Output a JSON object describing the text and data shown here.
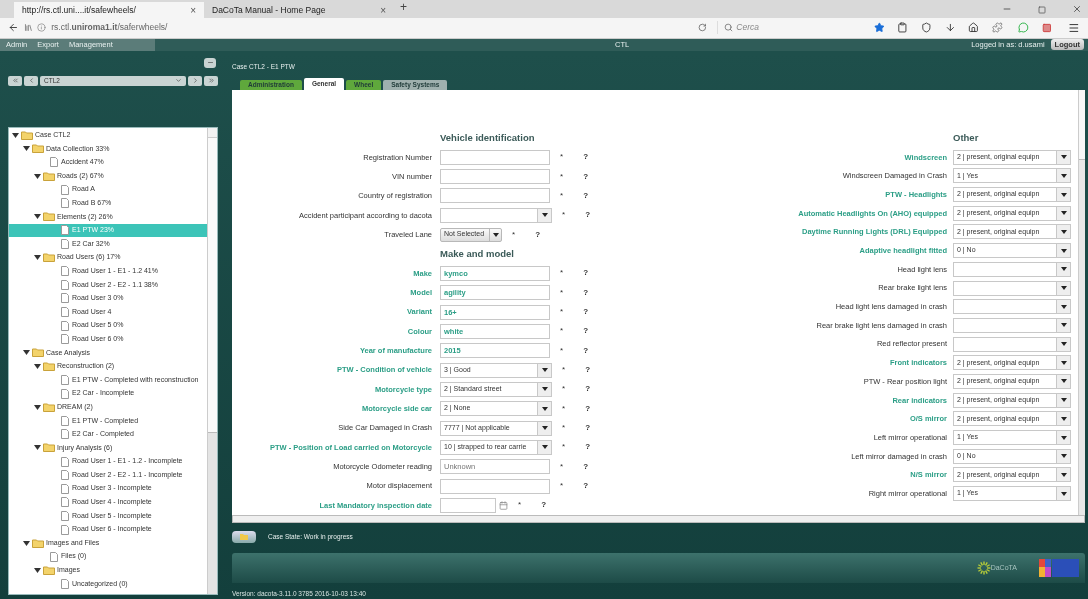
{
  "browser": {
    "tabs": [
      {
        "label": "http://rs.ctl.uni....it/safewheels/",
        "selected": true,
        "close": "×"
      },
      {
        "label": "DaCoTa Manual - Home Page",
        "selected": false,
        "close": "×"
      }
    ],
    "new_tab": "+",
    "url": "rs.ctl.**uniroma1.it**/saferwheels/",
    "search": {
      "placeholder": "Cerca"
    }
  },
  "app_bar": {
    "menu": [
      "Admin",
      "Export",
      "Management"
    ],
    "title": "CTL",
    "user": "Logged in as: d.usami",
    "logout": "Logout"
  },
  "navigator": {
    "case_select": "CTL2"
  },
  "tree": [
    {
      "label": "Case CTL2",
      "kind": "folder",
      "expanded": true,
      "selected": false,
      "children": [
        {
          "label": "Data Collection 33%",
          "kind": "folder",
          "expanded": true,
          "selected": false,
          "children": [
            {
              "label": "Accident 47%",
              "kind": "file",
              "selected": false
            },
            {
              "label": "Roads (2) 67%",
              "kind": "folder",
              "expanded": true,
              "selected": false,
              "children": [
                {
                  "label": "Road A",
                  "kind": "file",
                  "selected": false
                },
                {
                  "label": "Road B 67%",
                  "kind": "file",
                  "selected": false
                }
              ]
            },
            {
              "label": "Elements (2) 26%",
              "kind": "folder",
              "expanded": true,
              "selected": false,
              "children": [
                {
                  "label": "E1 PTW 23%",
                  "kind": "file",
                  "selected": true
                },
                {
                  "label": "E2 Car 32%",
                  "kind": "file",
                  "selected": false
                }
              ]
            },
            {
              "label": "Road Users (6) 17%",
              "kind": "folder",
              "expanded": true,
              "selected": false,
              "children": [
                {
                  "label": "Road User 1 - E1 - 1.2 41%",
                  "kind": "file",
                  "selected": false
                },
                {
                  "label": "Road User 2 - E2 - 1.1 38%",
                  "kind": "file",
                  "selected": false
                },
                {
                  "label": "Road User 3 0%",
                  "kind": "file",
                  "selected": false
                },
                {
                  "label": "Road User 4",
                  "kind": "file",
                  "selected": false
                },
                {
                  "label": "Road User 5 0%",
                  "kind": "file",
                  "selected": false
                },
                {
                  "label": "Road User 6 0%",
                  "kind": "file",
                  "selected": false
                }
              ]
            }
          ]
        },
        {
          "label": "Case Analysis",
          "kind": "folder",
          "expanded": true,
          "selected": false,
          "children": [
            {
              "label": "Reconstruction (2)",
              "kind": "folder",
              "expanded": true,
              "selected": false,
              "children": [
                {
                  "label": "E1 PTW - Completed with reconstruction",
                  "kind": "file",
                  "selected": false
                },
                {
                  "label": "E2 Car - Incomplete",
                  "kind": "file",
                  "selected": false
                }
              ]
            },
            {
              "label": "DREAM (2)",
              "kind": "folder",
              "expanded": true,
              "selected": false,
              "children": [
                {
                  "label": "E1 PTW - Completed",
                  "kind": "file",
                  "selected": false
                },
                {
                  "label": "E2 Car - Completed",
                  "kind": "file",
                  "selected": false
                }
              ]
            },
            {
              "label": "Injury Analysis (6)",
              "kind": "folder",
              "expanded": true,
              "selected": false,
              "children": [
                {
                  "label": "Road User 1 - E1 - 1.2 - Incomplete",
                  "kind": "file",
                  "selected": false
                },
                {
                  "label": "Road User 2 - E2 - 1.1 - Incomplete",
                  "kind": "file",
                  "selected": false
                },
                {
                  "label": "Road User 3 - Incomplete",
                  "kind": "file",
                  "selected": false
                },
                {
                  "label": "Road User 4 - Incomplete",
                  "kind": "file",
                  "selected": false
                },
                {
                  "label": "Road User 5 - Incomplete",
                  "kind": "file",
                  "selected": false
                },
                {
                  "label": "Road User 6 - Incomplete",
                  "kind": "file",
                  "selected": false
                }
              ]
            }
          ]
        },
        {
          "label": "Images and Files",
          "kind": "folder",
          "expanded": true,
          "selected": false,
          "children": [
            {
              "label": "Files (0)",
              "kind": "file",
              "selected": false
            },
            {
              "label": "Images",
              "kind": "folder",
              "expanded": true,
              "selected": false,
              "children": [
                {
                  "label": "Uncategorized (0)",
                  "kind": "file",
                  "selected": false
                }
              ]
            }
          ]
        }
      ]
    }
  ],
  "case_title": "Case CTL2 - E1 PTW",
  "tabs": [
    {
      "label": "Administration",
      "selected": false,
      "color": "#5fa83c"
    },
    {
      "label": "General",
      "selected": true,
      "color": "#ffffff"
    },
    {
      "label": "Wheel",
      "selected": false,
      "color": "#5fa83c"
    },
    {
      "label": "Safety Systems",
      "selected": false,
      "color": "#9fb0ae"
    }
  ],
  "form_left": [
    {
      "kind": "header",
      "title": "Vehicle identification"
    },
    {
      "kind": "text",
      "label": "Registration Number",
      "highlighted": false,
      "required": "*",
      "help": "?"
    },
    {
      "kind": "text",
      "label": "VIN number",
      "highlighted": false,
      "required": "*",
      "help": "?"
    },
    {
      "kind": "text",
      "label": "Country of registration",
      "highlighted": false,
      "required": "*",
      "help": "?"
    },
    {
      "kind": "select",
      "label": "Accident participant according to dacota",
      "highlighted": false,
      "required": "*",
      "help": "?"
    },
    {
      "kind": "small_select",
      "label": "Traveled Lane",
      "highlighted": false,
      "value": "Not Selected",
      "required": "*",
      "help": "?"
    },
    {
      "kind": "header",
      "title": "Make and model"
    },
    {
      "kind": "text",
      "label": "Make",
      "highlighted": true,
      "value": "kymco",
      "required": "*",
      "help": "?"
    },
    {
      "kind": "text",
      "label": "Model",
      "highlighted": true,
      "value": "agility",
      "required": "*",
      "help": "?"
    },
    {
      "kind": "text",
      "label": "Variant",
      "highlighted": true,
      "value": "16+",
      "required": "*",
      "help": "?"
    },
    {
      "kind": "text",
      "label": "Colour",
      "highlighted": true,
      "value": "white",
      "required": "*",
      "help": "?"
    },
    {
      "kind": "text",
      "label": "Year of manufacture",
      "highlighted": true,
      "value": "2015",
      "required": "*",
      "help": "?"
    },
    {
      "kind": "select",
      "label": "PTW - Condition of vehicle",
      "highlighted": true,
      "value": "3 | Good",
      "required": "*",
      "help": "?"
    },
    {
      "kind": "select",
      "label": "Motorcycle type",
      "highlighted": true,
      "value": "2 | Standard street",
      "required": "*",
      "help": "?"
    },
    {
      "kind": "select",
      "label": "Motorcycle side car",
      "highlighted": true,
      "value": "2 | None",
      "required": "*",
      "help": "?"
    },
    {
      "kind": "select",
      "label": "Side Car Damaged in Crash",
      "highlighted": false,
      "value": "7777 | Not applicable",
      "required": "*",
      "help": "?"
    },
    {
      "kind": "select",
      "label": "PTW - Position of Load carried on Motorcycle",
      "highlighted": true,
      "value": "10 | strapped to rear carrie",
      "required": "*",
      "help": "?"
    },
    {
      "kind": "text",
      "label": "Motorcycle Odometer reading",
      "highlighted": false,
      "placeholder": "Unknown",
      "required": "*",
      "help": "?"
    },
    {
      "kind": "text",
      "label": "Motor displacement",
      "highlighted": false,
      "required": "*",
      "help": "?"
    },
    {
      "kind": "date",
      "label": "Last Mandatory inspection date",
      "highlighted": true,
      "required": "*",
      "help": "?"
    }
  ],
  "form_right": {
    "title": "Other",
    "rows": [
      {
        "label": "Windscreen",
        "highlighted": true,
        "value": "2 | present, original equipn"
      },
      {
        "label": "Windscreen Damaged in Crash",
        "highlighted": false,
        "value": "1 | Yes"
      },
      {
        "label": "PTW - Headlights",
        "highlighted": true,
        "value": "2 | present, original equipn"
      },
      {
        "label": "Automatic Headlights On (AHO) equipped",
        "highlighted": true,
        "value": "2 | present, original equipn"
      },
      {
        "label": "Daytime Running Lights (DRL) Equipped",
        "highlighted": true,
        "value": "2 | present, original equipn"
      },
      {
        "label": "Adaptive headlight fitted",
        "highlighted": true,
        "value": "0 | No"
      },
      {
        "label": "Head light lens",
        "highlighted": false
      },
      {
        "label": "Rear brake light lens",
        "highlighted": false
      },
      {
        "label": "Head light lens damaged in crash",
        "highlighted": false
      },
      {
        "label": "Rear brake light lens damaged in crash",
        "highlighted": false
      },
      {
        "label": "Red reflector present",
        "highlighted": false
      },
      {
        "label": "Front indicators",
        "highlighted": true,
        "value": "2 | present, original equipn"
      },
      {
        "label": "PTW - Rear position light",
        "highlighted": false,
        "value": "2 | present, original equipn"
      },
      {
        "label": "Rear indicators",
        "highlighted": true,
        "value": "2 | present, original equipn"
      },
      {
        "label": "O/S mirror",
        "highlighted": true,
        "value": "2 | present, original equipn"
      },
      {
        "label": "Left mirror operational",
        "highlighted": false,
        "value": "1 | Yes"
      },
      {
        "label": "Left mirror damaged in crash",
        "highlighted": false,
        "value": "0 | No"
      },
      {
        "label": "N/S mirror",
        "highlighted": true,
        "value": "2 | present, original equipn"
      },
      {
        "label": "Right mirror operational",
        "highlighted": false,
        "value": "1 | Yes"
      }
    ]
  },
  "case_state": "Case State: Work in progress",
  "footer": {
    "logo_text": "DaCoTA"
  },
  "version": "Version: dacota-3.11.0 3785 2016-10-03 13:40"
}
